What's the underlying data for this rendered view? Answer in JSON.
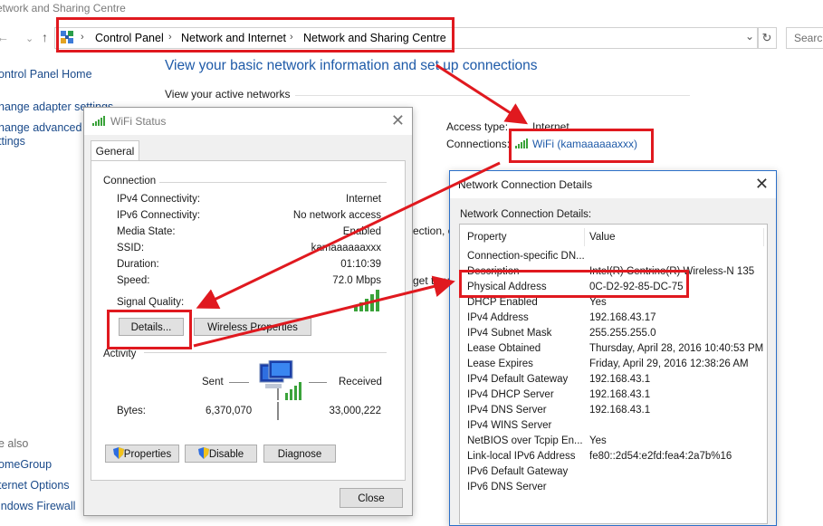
{
  "window": {
    "title": "etwork and Sharing Centre"
  },
  "nav": {
    "back": "←",
    "forward": "→",
    "recent": "⌄",
    "up": "↑",
    "breadcrumbs": [
      "Control Panel",
      "Network and Internet",
      "Network and Sharing Centre"
    ],
    "separator": "›",
    "dropdown": "⌄",
    "refresh": "↻",
    "search_placeholder": "Search"
  },
  "left_pane": {
    "home": "ontrol Panel Home",
    "adapter": "hange adapter settings",
    "advanced_1": "hange advanced s",
    "advanced_2": "ttings",
    "see_also": "e also",
    "homegroup": "omeGroup",
    "internet_options": "ternet Options",
    "firewall": "indows Firewall"
  },
  "main": {
    "heading": "View your basic network information and set up connections",
    "active_networks": "View your active networks",
    "access_type_label": "Access type:",
    "access_type_value": "Internet",
    "connections_label": "Connections:",
    "connection_link": "WiFi (kamaaaaaaxxx)",
    "partial_1": "ection, o",
    "partial_2": "get trou"
  },
  "wifi_status": {
    "title": "WiFi Status",
    "close": "✕",
    "tab": "General",
    "connection_group": "Connection",
    "rows": [
      {
        "label": "IPv4 Connectivity:",
        "value": "Internet"
      },
      {
        "label": "IPv6 Connectivity:",
        "value": "No network access"
      },
      {
        "label": "Media State:",
        "value": "Enabled"
      },
      {
        "label": "SSID:",
        "value": "kamaaaaaaxxx"
      },
      {
        "label": "Duration:",
        "value": "01:10:39"
      },
      {
        "label": "Speed:",
        "value": "72.0 Mbps"
      }
    ],
    "signal_quality_label": "Signal Quality:",
    "signal_bars": 5,
    "details_button": "Details...",
    "wireless_properties_button": "Wireless Properties",
    "activity_group": "Activity",
    "sent_label": "Sent",
    "received_label": "Received",
    "bytes_label": "Bytes:",
    "bytes_sent": "6,370,070",
    "bytes_received": "33,000,222",
    "properties_button": "Properties",
    "disable_button": "Disable",
    "diagnose_button": "Diagnose",
    "close_button": "Close"
  },
  "net_details": {
    "title": "Network Connection Details",
    "close": "✕",
    "subtitle": "Network Connection Details:",
    "col_property": "Property",
    "col_value": "Value",
    "rows": [
      {
        "p": "Connection-specific DN...",
        "v": ""
      },
      {
        "p": "Description",
        "v": "Intel(R) Centrino(R) Wireless-N 135"
      },
      {
        "p": "Physical Address",
        "v": "0C-D2-92-85-DC-75"
      },
      {
        "p": "DHCP Enabled",
        "v": "Yes"
      },
      {
        "p": "IPv4 Address",
        "v": "192.168.43.17"
      },
      {
        "p": "IPv4 Subnet Mask",
        "v": "255.255.255.0"
      },
      {
        "p": "Lease Obtained",
        "v": "Thursday, April 28, 2016 10:40:53 PM"
      },
      {
        "p": "Lease Expires",
        "v": "Friday, April 29, 2016 12:38:26 AM"
      },
      {
        "p": "IPv4 Default Gateway",
        "v": "192.168.43.1"
      },
      {
        "p": "IPv4 DHCP Server",
        "v": "192.168.43.1"
      },
      {
        "p": "IPv4 DNS Server",
        "v": "192.168.43.1"
      },
      {
        "p": "IPv4 WINS Server",
        "v": ""
      },
      {
        "p": "NetBIOS over Tcpip En...",
        "v": "Yes"
      },
      {
        "p": "Link-local IPv6 Address",
        "v": "fe80::2d54:e2fd:fea4:2a7b%16"
      },
      {
        "p": "IPv6 Default Gateway",
        "v": ""
      },
      {
        "p": "IPv6 DNS Server",
        "v": ""
      }
    ]
  },
  "colors": {
    "annotation_red": "#e0191f",
    "link_blue": "#1e5aa8",
    "signal_green": "#3aa33a"
  }
}
